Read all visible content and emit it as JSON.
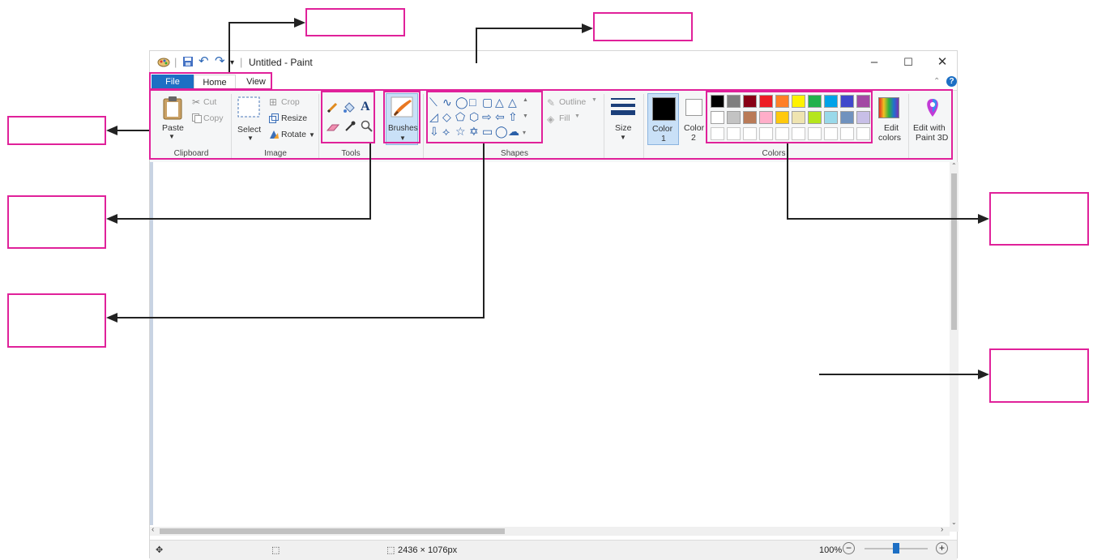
{
  "window": {
    "title": "Untitled - Paint"
  },
  "window_controls": {
    "minimize": "–",
    "maximize": "☐",
    "close": "✕"
  },
  "tabs": [
    {
      "label": "File"
    },
    {
      "label": "Home"
    },
    {
      "label": "View"
    }
  ],
  "ribbon": {
    "clipboard": {
      "paste": "Paste",
      "cut": "Cut",
      "copy": "Copy",
      "group": "Clipboard"
    },
    "image": {
      "select": "Select",
      "crop": "Crop",
      "resize": "Resize",
      "rotate": "Rotate",
      "group": "Image"
    },
    "tools": {
      "group": "Tools",
      "brushes": "Brushes"
    },
    "shapes": {
      "group": "Shapes",
      "outline": "Outline",
      "fill": "Fill"
    },
    "size": {
      "label": "Size"
    },
    "colors": {
      "color1_line1": "Color",
      "color1_line2": "1",
      "color2_line1": "Color",
      "color2_line2": "2",
      "edit_colors_line1": "Edit",
      "edit_colors_line2": "colors",
      "edit3d_line1": "Edit with",
      "edit3d_line2": "Paint 3D",
      "group": "Colors",
      "palette_row1": [
        "#000000",
        "#7f7f7f",
        "#880015",
        "#ed1c24",
        "#ff7f27",
        "#fff200",
        "#22b14c",
        "#00a2e8",
        "#3f48cc",
        "#a349a4"
      ],
      "palette_row2": [
        "#ffffff",
        "#c3c3c3",
        "#b97a57",
        "#ffaec9",
        "#ffc90e",
        "#efe4b0",
        "#b5e61d",
        "#99d9ea",
        "#7092be",
        "#c8bfe7"
      ]
    }
  },
  "statusbar": {
    "dimensions": "2436 × 1076px",
    "zoom": "100%",
    "zoom_level": 100
  },
  "icons": [
    "paint-app-icon",
    "save-icon",
    "undo-icon",
    "redo-icon",
    "clipboard-icon",
    "scissors-icon",
    "copy-icon",
    "select-icon",
    "crop-icon",
    "resize-icon",
    "rotate-icon",
    "pencil-icon",
    "fill-bucket-icon",
    "text-icon",
    "eraser-icon",
    "color-picker-icon",
    "magnifier-icon",
    "brush-icon",
    "size-lines-icon",
    "rainbow-icon",
    "paint3d-icon",
    "help-icon"
  ]
}
